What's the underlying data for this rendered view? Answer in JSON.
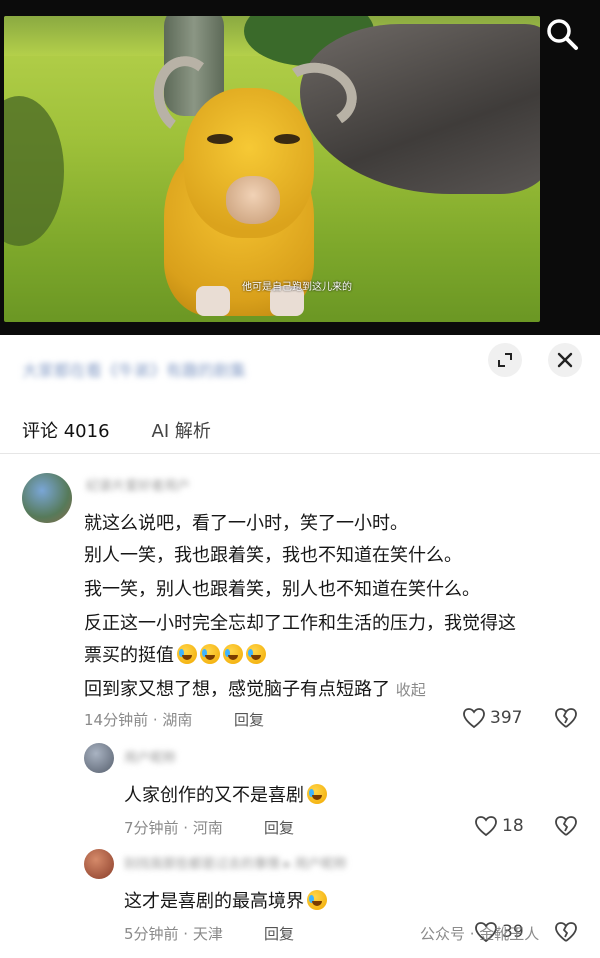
{
  "video": {
    "subtitle": "他可是自己跑到这儿来的",
    "search_icon": "search-icon"
  },
  "sheet": {
    "title": "大家都在看《牛弟》有趣的剧集",
    "expand_icon": "expand-icon",
    "close_icon": "close-icon",
    "tabs": [
      {
        "label": "评论 4016",
        "active": true
      },
      {
        "label": "AI 解析",
        "active": false
      }
    ]
  },
  "comments": [
    {
      "username": "纪录片爱好者用户",
      "lines": [
        "就这么说吧，看了一小时，笑了一小时。",
        "别人一笑，我也跟着笑，我也不知道在笑什么。",
        "我一笑，别人也跟着笑，别人也不知道在笑什么。",
        "反正这一小时完全忘却了工作和生活的压力，我觉得这",
        "票买的挺值",
        "回到家又想了想，感觉脑子有点短路了"
      ],
      "collapse_label": "收起",
      "time_location": "14分钟前 · 湖南",
      "reply_label": "回复",
      "likes": "397"
    },
    {
      "username": "用户昵称",
      "text": "人家创作的又不是喜剧",
      "time_location": "7分钟前 · 河南",
      "reply_label": "回复",
      "likes": "18"
    },
    {
      "username": "别找我那些都是过去的事情 ▸ 用户昵称",
      "text": "这才是喜剧的最高境界",
      "time_location": "5分钟前 · 天津",
      "reply_label": "回复",
      "likes": "39"
    }
  ],
  "watermark": "公众号 · 金靴王人",
  "colors": {
    "accent_text": "#111111",
    "muted": "#8a8a8a",
    "emoji_yellow": "#ffd64a"
  }
}
